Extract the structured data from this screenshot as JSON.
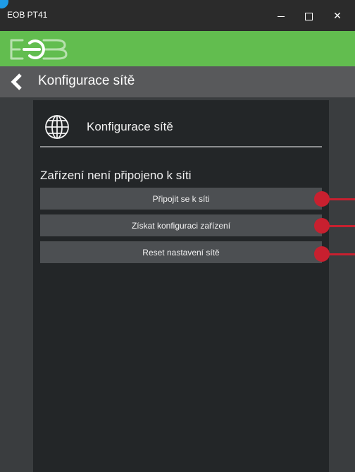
{
  "window": {
    "title": "EOB PT41",
    "minimize_icon": "minimize-icon",
    "maximize_icon": "maximize-icon",
    "close_icon": "close-icon",
    "close_glyph": "✕"
  },
  "brand": {
    "logo": "eob-logo",
    "color": "#62bd4f"
  },
  "nav": {
    "back_icon": "chevron-left-icon",
    "title": "Konfigurace sítě"
  },
  "panel": {
    "icon": "globe-icon",
    "title": "Konfigurace sítě",
    "status": "Zařízení není připojeno k síti",
    "buttons": [
      {
        "label": "Připojit se k síti"
      },
      {
        "label": "Získat konfiguraci zařízení"
      },
      {
        "label": "Reset nastavení sítě"
      }
    ]
  },
  "colors": {
    "marker": "#c8202f",
    "button": "#4c4f52",
    "panel": "#232628"
  }
}
